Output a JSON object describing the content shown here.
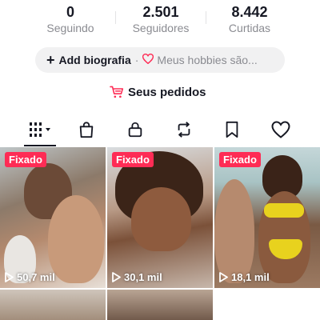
{
  "stats": [
    {
      "value": "0",
      "label": "Seguindo"
    },
    {
      "value": "2.501",
      "label": "Seguidores"
    },
    {
      "value": "8.442",
      "label": "Curtidas"
    }
  ],
  "bio": {
    "add_label": "Add biografia",
    "separator": "·",
    "hobbies_label": "Meus hobbies são..."
  },
  "orders": {
    "label": "Seus pedidos"
  },
  "tabs": [
    {
      "name": "videos",
      "icon": "grid-icon",
      "active": true
    },
    {
      "name": "shop",
      "icon": "shopping-bag-icon"
    },
    {
      "name": "private",
      "icon": "lock-icon"
    },
    {
      "name": "reposts",
      "icon": "repost-icon"
    },
    {
      "name": "favorites",
      "icon": "bookmark-icon"
    },
    {
      "name": "liked",
      "icon": "heart-icon"
    }
  ],
  "videos": [
    {
      "pinned_label": "Fixado",
      "views": "50,7 mil"
    },
    {
      "pinned_label": "Fixado",
      "views": "30,1 mil"
    },
    {
      "pinned_label": "Fixado",
      "views": "18,1 mil"
    }
  ],
  "colors": {
    "accent": "#fe2c55",
    "text": "#161823",
    "muted": "#8a8b91",
    "pill": "#f1f1f2"
  }
}
